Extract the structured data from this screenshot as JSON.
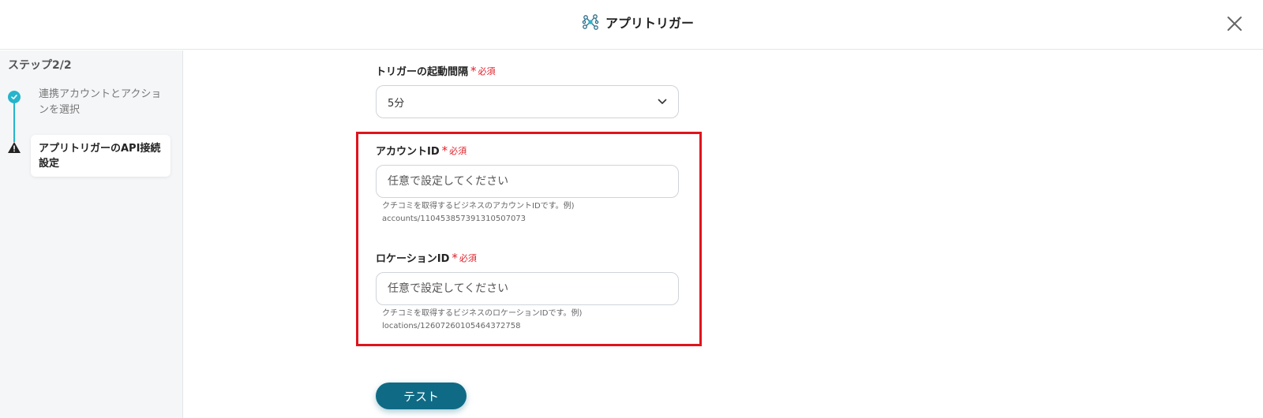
{
  "header": {
    "title": "アプリトリガー",
    "icon": "network-nodes-icon",
    "close_icon": "close-icon"
  },
  "sidebar": {
    "step_count": "ステップ2/2",
    "steps": [
      {
        "label": "連携アカウントとアクションを選択",
        "status": "completed",
        "icon": "check-circle-icon"
      },
      {
        "label": "アプリトリガーのAPI接続設定",
        "status": "current-warning",
        "icon": "warning-icon"
      }
    ]
  },
  "form": {
    "required_text": "必須",
    "interval": {
      "label": "トリガーの起動間隔",
      "value": "5分"
    },
    "account_id": {
      "label": "アカウントID",
      "placeholder": "任意で設定してください",
      "help_line1": "クチコミを取得するビジネスのアカウントIDです。例)",
      "help_line2": "accounts/110453857391310507073"
    },
    "location_id": {
      "label": "ロケーションID",
      "placeholder": "任意で設定してください",
      "help_line1": "クチコミを取得するビジネスのロケーションIDです。例)",
      "help_line2": "locations/12607260105464372758"
    },
    "test_button": "テスト"
  },
  "colors": {
    "accent": "#25b5cc",
    "button": "#0f6b85",
    "required": "#e0202a",
    "highlight": "#e0141c"
  }
}
